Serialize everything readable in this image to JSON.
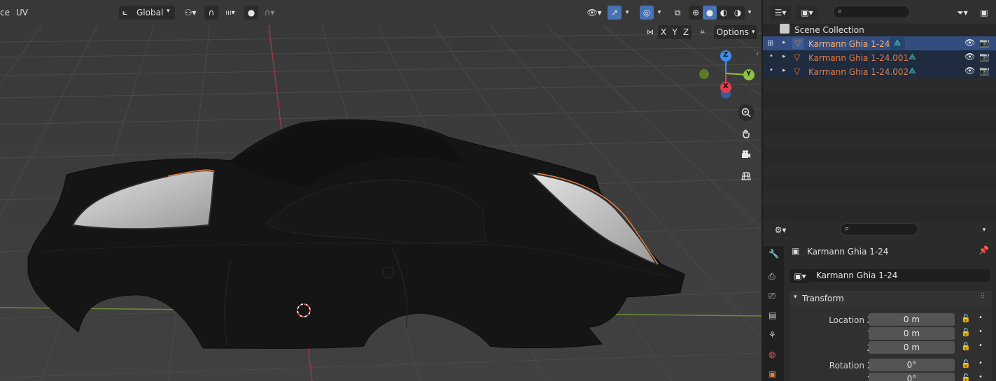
{
  "header": {
    "left_partial": "ce",
    "uv_menu": "UV",
    "transform_orientation": "Global",
    "options_label": "Options",
    "axis_x": "X",
    "axis_y": "Y",
    "axis_z": "Z"
  },
  "gizmo": {
    "z_label": "Z",
    "y_label": "Y",
    "x_label": "X"
  },
  "outliner": {
    "scene_collection": "Scene Collection",
    "items": [
      {
        "label": "Karmann Ghia 1-24"
      },
      {
        "label": "Karmann Ghia 1-24.001"
      },
      {
        "label": "Karmann Ghia 1-24.002"
      }
    ]
  },
  "properties": {
    "object_name": "Karmann Ghia 1-24",
    "datablock_name": "Karmann Ghia 1-24",
    "transform_panel": "Transform",
    "location_x_label": "Location X",
    "location_y_label": "Y",
    "location_z_label": "Z",
    "location_x": "0 m",
    "location_y": "0 m",
    "location_z": "0 m",
    "rotation_x_label": "Rotation X",
    "rotation_y_label": "Y",
    "rotation_x": "0°",
    "rotation_y": "0°"
  },
  "colors": {
    "viewport_bg": "#3d3d3d",
    "selection_blue": "#4772b3",
    "object_orange": "#e87d3e",
    "axis_x": "#e53b4f",
    "axis_y": "#8bc43f",
    "axis_z": "#3a8df2"
  }
}
